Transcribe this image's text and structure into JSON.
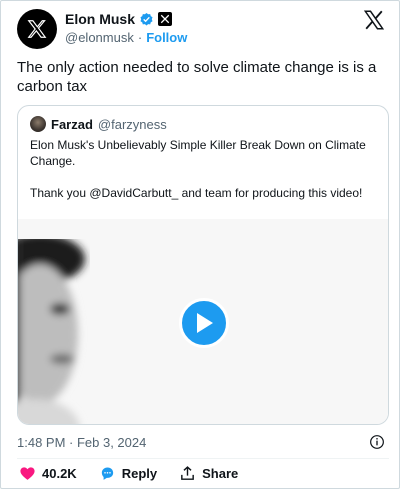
{
  "author": {
    "name": "Elon Musk",
    "handle": "@elonmusk",
    "separator": "·",
    "follow_label": "Follow"
  },
  "tweet": {
    "text": "The only action needed to solve climate change is is a carbon tax"
  },
  "quote": {
    "name": "Farzad",
    "handle": "@farzyness",
    "text": "Elon Musk's Unbelievably Simple Killer Break Down on Climate Change.\n\nThank you @DavidCarbutt_ and team for producing this video!"
  },
  "meta": {
    "timestamp": "1:48 PM · Feb 3, 2024"
  },
  "actions": {
    "like_count": "40.2K",
    "reply_label": "Reply",
    "share_label": "Share"
  },
  "colors": {
    "accent": "#1d9bf0",
    "like": "#f91880",
    "text": "#0f1419",
    "muted": "#536471"
  },
  "icons": [
    "x-logo-icon",
    "verified-icon",
    "x-badge-icon",
    "play-icon",
    "info-icon",
    "heart-icon",
    "reply-icon",
    "share-icon"
  ]
}
